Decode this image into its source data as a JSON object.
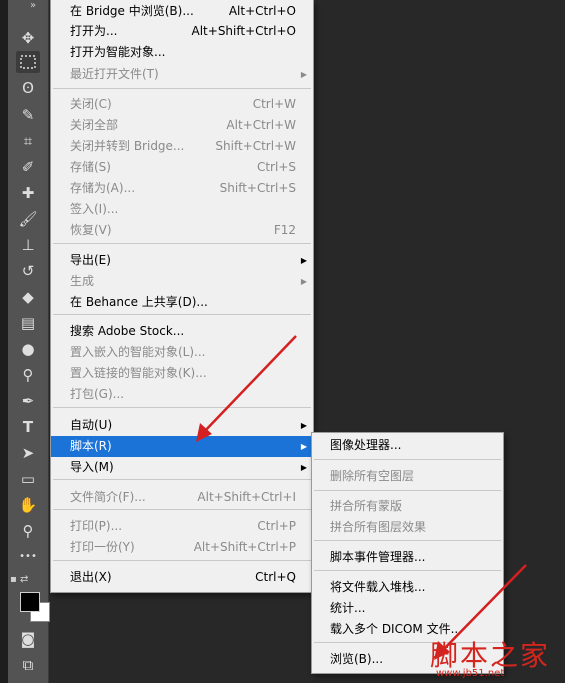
{
  "toolbar": {
    "top_glyph": "»",
    "tools": [
      {
        "name": "move-tool-icon",
        "glyph": "✥"
      },
      {
        "name": "marquee-tool-icon",
        "glyph": ""
      },
      {
        "name": "lasso-tool-icon",
        "glyph": "ʘ"
      },
      {
        "name": "quick-select-tool-icon",
        "glyph": "✎"
      },
      {
        "name": "crop-tool-icon",
        "glyph": "⌗"
      },
      {
        "name": "eyedropper-tool-icon",
        "glyph": "✐"
      },
      {
        "name": "healing-brush-tool-icon",
        "glyph": "✚"
      },
      {
        "name": "brush-tool-icon",
        "glyph": "🖌"
      },
      {
        "name": "clone-stamp-tool-icon",
        "glyph": "⊥"
      },
      {
        "name": "history-brush-tool-icon",
        "glyph": "↺"
      },
      {
        "name": "eraser-tool-icon",
        "glyph": "◆"
      },
      {
        "name": "gradient-tool-icon",
        "glyph": "▤"
      },
      {
        "name": "blur-tool-icon",
        "glyph": "●"
      },
      {
        "name": "dodge-tool-icon",
        "glyph": "⚲"
      },
      {
        "name": "pen-tool-icon",
        "glyph": "✒"
      },
      {
        "name": "type-tool-icon",
        "glyph": "T"
      },
      {
        "name": "path-select-tool-icon",
        "glyph": "➤"
      },
      {
        "name": "rectangle-tool-icon",
        "glyph": "▭"
      },
      {
        "name": "hand-tool-icon",
        "glyph": "✋"
      },
      {
        "name": "zoom-tool-icon",
        "glyph": "⚲"
      },
      {
        "name": "more-tools-icon",
        "glyph": "•••"
      }
    ],
    "foreground_color": "#000000",
    "background_color": "#ffffff",
    "bottom": [
      {
        "name": "quick-mask-icon",
        "glyph": "◙"
      },
      {
        "name": "screen-mode-icon",
        "glyph": "⧉"
      }
    ]
  },
  "menu": {
    "items": [
      {
        "label": "在 Bridge 中浏览(B)...",
        "shortcut": "Alt+Ctrl+O",
        "disabled": false
      },
      {
        "label": "打开为...",
        "shortcut": "Alt+Shift+Ctrl+O",
        "disabled": false
      },
      {
        "label": "打开为智能对象...",
        "shortcut": "",
        "disabled": false
      },
      {
        "label": "最近打开文件(T)",
        "shortcut": "",
        "disabled": true,
        "submenu": true
      },
      {
        "label": "关闭(C)",
        "shortcut": "Ctrl+W",
        "disabled": true
      },
      {
        "label": "关闭全部",
        "shortcut": "Alt+Ctrl+W",
        "disabled": true
      },
      {
        "label": "关闭并转到 Bridge...",
        "shortcut": "Shift+Ctrl+W",
        "disabled": true
      },
      {
        "label": "存储(S)",
        "shortcut": "Ctrl+S",
        "disabled": true
      },
      {
        "label": "存储为(A)...",
        "shortcut": "Shift+Ctrl+S",
        "disabled": true
      },
      {
        "label": "签入(I)...",
        "shortcut": "",
        "disabled": true
      },
      {
        "label": "恢复(V)",
        "shortcut": "F12",
        "disabled": true
      },
      {
        "label": "导出(E)",
        "shortcut": "",
        "disabled": false,
        "submenu": true
      },
      {
        "label": "生成",
        "shortcut": "",
        "disabled": true,
        "submenu": true
      },
      {
        "label": "在 Behance 上共享(D)...",
        "shortcut": "",
        "disabled": false
      },
      {
        "label": "搜索 Adobe Stock...",
        "shortcut": "",
        "disabled": false
      },
      {
        "label": "置入嵌入的智能对象(L)...",
        "shortcut": "",
        "disabled": true
      },
      {
        "label": "置入链接的智能对象(K)...",
        "shortcut": "",
        "disabled": true
      },
      {
        "label": "打包(G)...",
        "shortcut": "",
        "disabled": true
      },
      {
        "label": "自动(U)",
        "shortcut": "",
        "disabled": false,
        "submenu": true
      },
      {
        "label": "脚本(R)",
        "shortcut": "",
        "disabled": false,
        "submenu": true,
        "highlighted": true
      },
      {
        "label": "导入(M)",
        "shortcut": "",
        "disabled": false,
        "submenu": true
      },
      {
        "label": "文件简介(F)...",
        "shortcut": "Alt+Shift+Ctrl+I",
        "disabled": true
      },
      {
        "label": "打印(P)...",
        "shortcut": "Ctrl+P",
        "disabled": true
      },
      {
        "label": "打印一份(Y)",
        "shortcut": "Alt+Shift+Ctrl+P",
        "disabled": true
      },
      {
        "label": "退出(X)",
        "shortcut": "Ctrl+Q",
        "disabled": false
      }
    ]
  },
  "submenu": {
    "items": [
      {
        "label": "图像处理器...",
        "disabled": false
      },
      {
        "label": "删除所有空图层",
        "disabled": true
      },
      {
        "label": "拼合所有蒙版",
        "disabled": true
      },
      {
        "label": "拼合所有图层效果",
        "disabled": true
      },
      {
        "label": "脚本事件管理器...",
        "disabled": false
      },
      {
        "label": "将文件载入堆栈...",
        "disabled": false
      },
      {
        "label": "统计...",
        "disabled": false
      },
      {
        "label": "载入多个 DICOM 文件...",
        "disabled": false
      },
      {
        "label": "浏览(B)...",
        "disabled": false
      }
    ]
  },
  "watermark": {
    "text": "脚本之家",
    "url": "www.jb51.net",
    "color": "#d4261f"
  },
  "annotation_color": "#d42020"
}
